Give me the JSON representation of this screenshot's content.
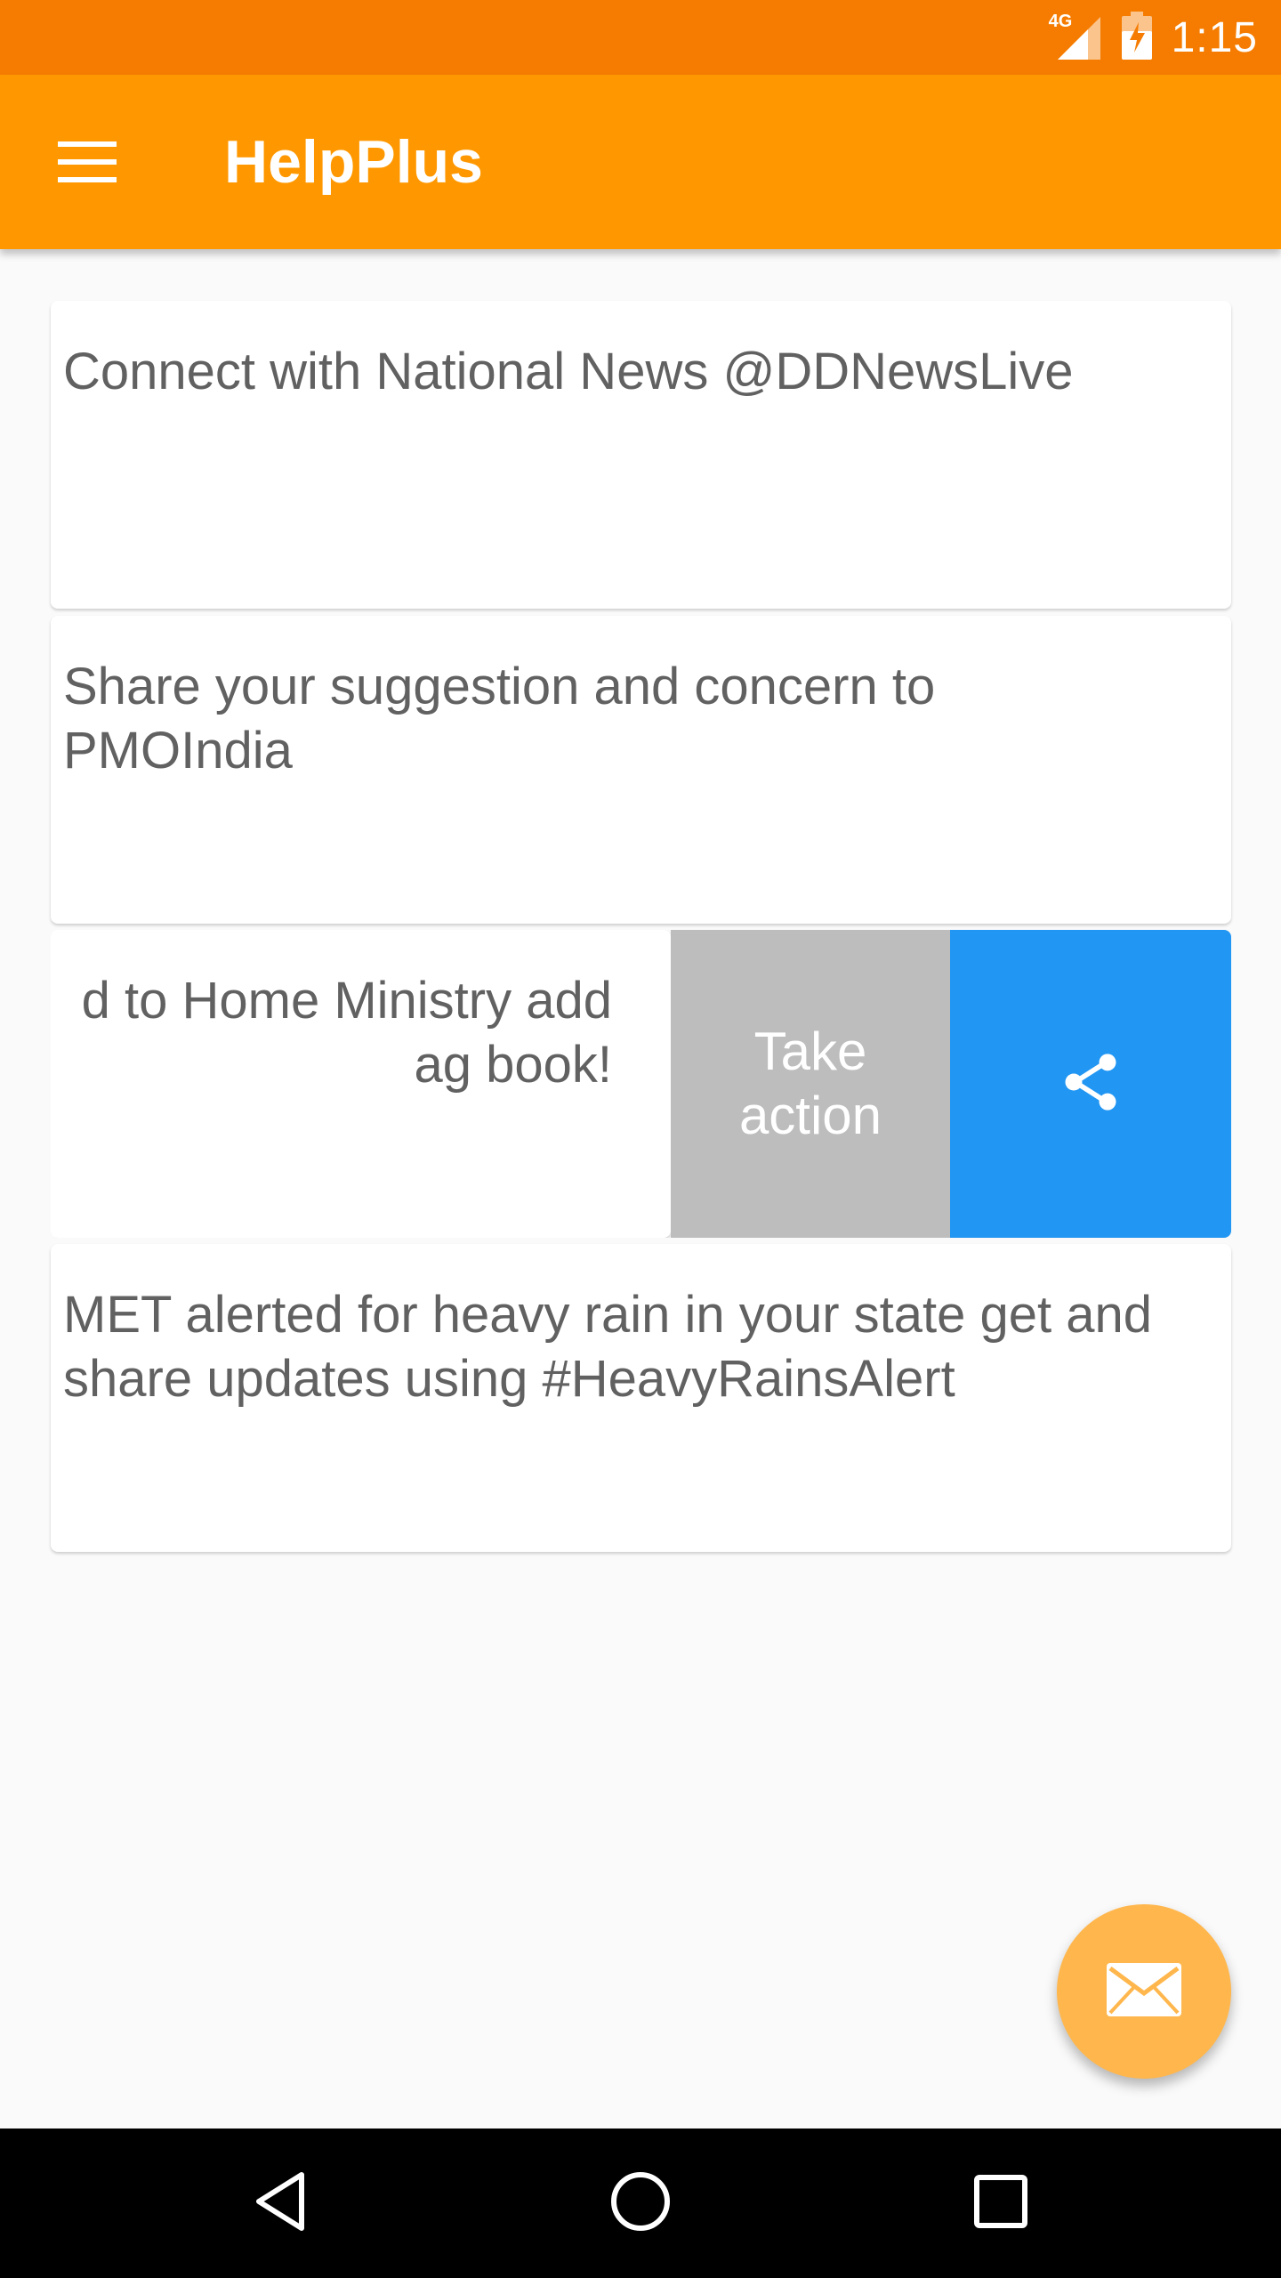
{
  "status_bar": {
    "network": "4G",
    "time": "1:15",
    "icons": [
      "signal-icon",
      "battery-charging-icon"
    ]
  },
  "app_bar": {
    "title": "HelpPlus",
    "menu_icon": "menu-icon"
  },
  "cards": [
    {
      "text": "Connect with National News @DDNewsLive"
    },
    {
      "text": "Share your suggestion and concern to PMOIndia"
    },
    {
      "text_line1": "d to Home Ministry add",
      "text_line2": "ag book!",
      "actions": {
        "take_action_line1": "Take",
        "take_action_line2": "action",
        "share_icon": "share-icon"
      }
    },
    {
      "text": "MET alerted for heavy rain in your state get and share updates using #HeavyRainsAlert"
    }
  ],
  "fab": {
    "icon": "mail-icon"
  },
  "nav_bar": {
    "icons": [
      "back-icon",
      "home-icon",
      "recents-icon"
    ]
  },
  "colors": {
    "status_bar": "#f57c00",
    "app_bar": "#ff9800",
    "take_action": "#bdbdbd",
    "share": "#2196f3",
    "fab": "#ffb74d"
  }
}
